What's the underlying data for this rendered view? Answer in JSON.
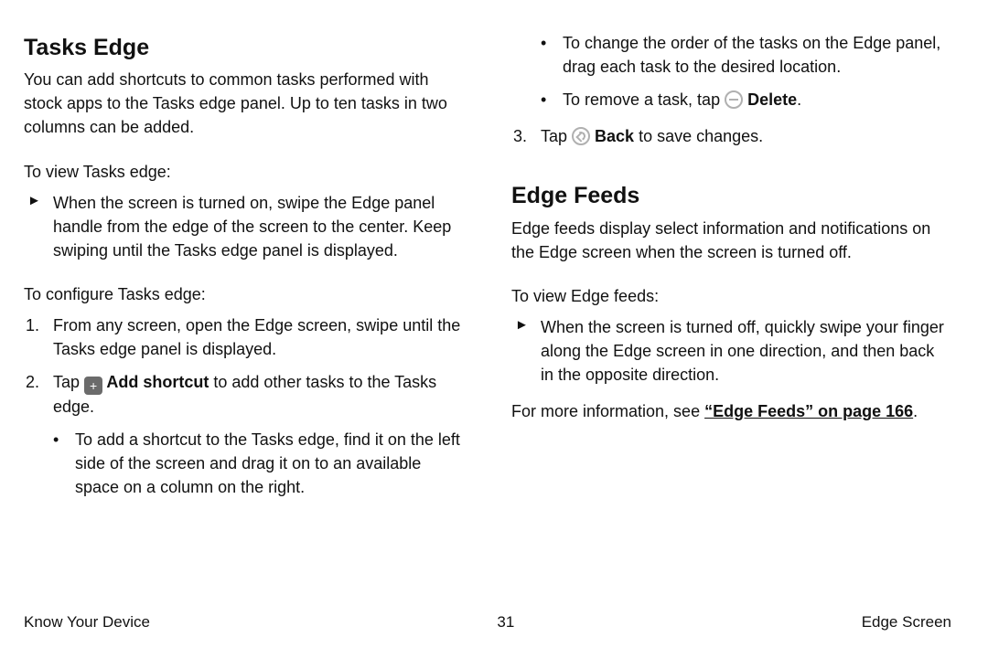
{
  "left": {
    "h2": "Tasks Edge",
    "intro": "You can add shortcuts to common tasks performed with stock apps to the Tasks edge panel. Up to ten tasks in two columns can be added.",
    "view_label": "To view Tasks edge:",
    "view_item": "When the screen is turned on, swipe the Edge panel handle from the edge of the screen to the center. Keep swiping until the Tasks edge panel is displayed.",
    "config_label": "To configure Tasks edge:",
    "step1": "From any screen, open the Edge screen, swipe until the Tasks edge panel is displayed.",
    "step2_pre": "Tap ",
    "step2_bold": " Add shortcut",
    "step2_post": " to add other tasks to the Tasks edge.",
    "sub_a": "To add a shortcut to the Tasks edge, find it on the left side of the screen and drag it on to an available space on a column on the right."
  },
  "right": {
    "sub_b": "To change the order of the tasks on the Edge panel, drag each task to the desired location.",
    "sub_c_pre": "To remove a task, tap ",
    "sub_c_bold": " Delete",
    "sub_c_post": ".",
    "step3_pre": "Tap ",
    "step3_bold": " Back",
    "step3_post": " to save changes.",
    "h2": "Edge Feeds",
    "intro": "Edge feeds display select information and notifications on the Edge screen when the screen is turned off.",
    "view_label": "To view Edge feeds:",
    "view_item": "When the screen is turned off, quickly swipe your finger along the Edge screen in one direction, and then back in the opposite direction.",
    "more_pre": "For more information, see ",
    "more_link": "“Edge Feeds” on page 166",
    "more_post": "."
  },
  "footer": {
    "left": "Know Your Device",
    "center": "31",
    "right": "Edge Screen"
  }
}
